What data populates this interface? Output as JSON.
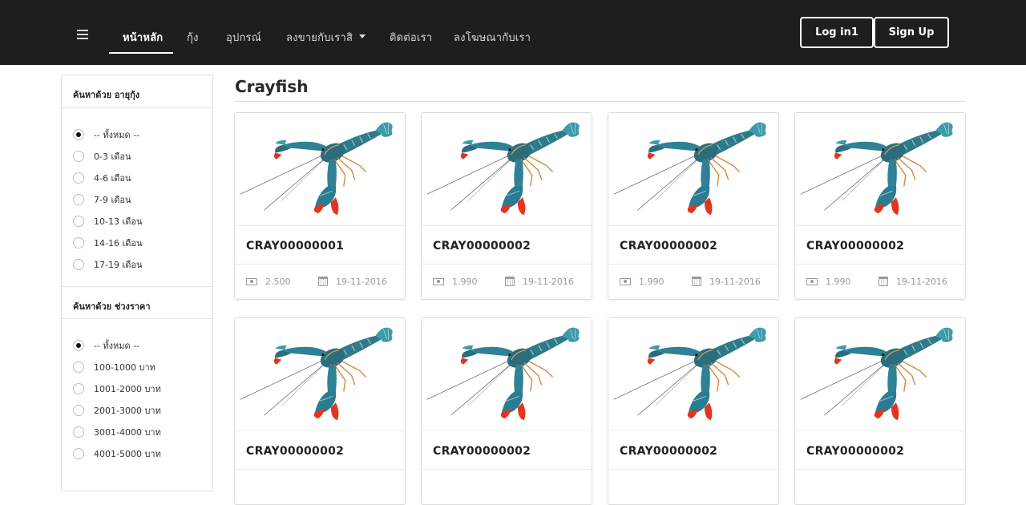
{
  "nav": {
    "items": [
      "หน้าหลัก",
      "กุ้ง",
      "อุปกรณ์",
      "ลงขายกับเราสิ",
      "ติดต่อเรา",
      "ลงโฆษณากับเรา"
    ],
    "login": "Log in1",
    "signup": "Sign Up"
  },
  "sidebar": {
    "age_title": "ค้นหาด้วย อายุกุ้ง",
    "age_options": [
      "-- ทั้งหมด --",
      "0-3 เดือน",
      "4-6 เดือน",
      "7-9 เดือน",
      "10-13 เดือน",
      "14-16 เดือน",
      "17-19 เดือน"
    ],
    "price_title": "ค้นหาด้วย ช่วงราคา",
    "price_options": [
      "-- ทั้งหมด --",
      "100-1000 บาท",
      "1001-2000 บาท",
      "2001-3000 บาท",
      "3001-4000 บาท",
      "4001-5000 บาท"
    ]
  },
  "main": {
    "title": "Crayfish",
    "products": [
      {
        "code": "CRAY00000001",
        "price": "2.500",
        "date": "19-11-2016"
      },
      {
        "code": "CRAY00000002",
        "price": "1.990",
        "date": "19-11-2016"
      },
      {
        "code": "CRAY00000002",
        "price": "1.990",
        "date": "19-11-2016"
      },
      {
        "code": "CRAY00000002",
        "price": "1.990",
        "date": "19-11-2016"
      },
      {
        "code": "CRAY00000002"
      },
      {
        "code": "CRAY00000002"
      },
      {
        "code": "CRAY00000002"
      },
      {
        "code": "CRAY00000002"
      }
    ]
  },
  "colors": {
    "navbar_bg": "#1e1e1e",
    "crayfish_blue": "#2a7c92",
    "crayfish_red": "#e2351f"
  }
}
